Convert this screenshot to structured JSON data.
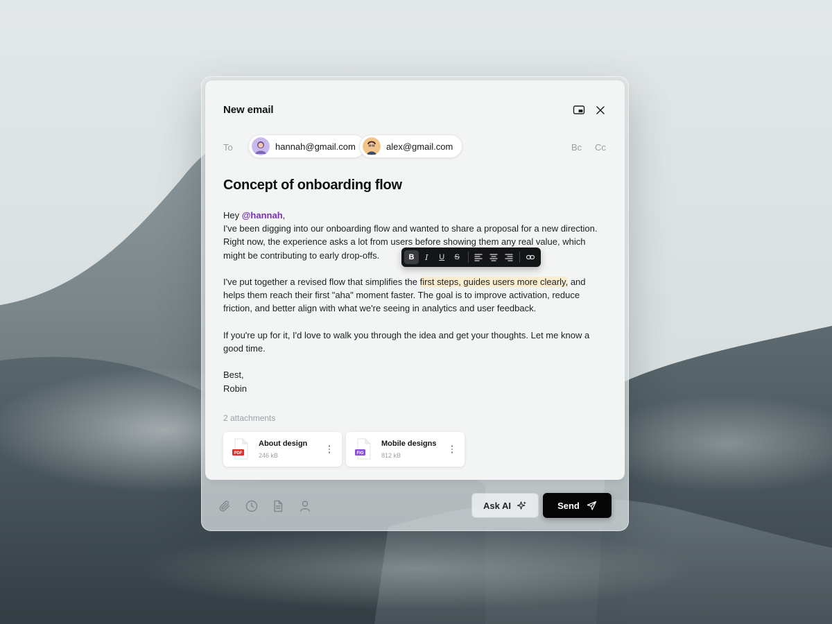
{
  "compose": {
    "title": "New email",
    "header_icons": [
      "minimize-window-icon",
      "close-icon"
    ]
  },
  "recipients": {
    "label": "To",
    "list": [
      {
        "email": "hannah@gmail.com",
        "avatar_color": "#c9b8ee"
      },
      {
        "email": "alex@gmail.com",
        "avatar_color": "#f2c48a"
      }
    ],
    "bcc_label": "Bc",
    "cc_label": "Cc"
  },
  "subject": "Concept of onboarding flow",
  "body": {
    "greeting": "Hey ",
    "mention": "@hannah",
    "greeting_end": ",",
    "p1": "I've been digging into our onboarding flow and wanted to share a proposal for a new direction. Right now, the experience asks a lot from users before showing them any real value, which might be contributing to early drop-offs.",
    "p2_before": "I've put together a revised flow that simplifies the ",
    "p2_highlight": "first steps, guides users more clearly,",
    "p2_after": " and helps them reach their first \"aha\" moment faster. The goal is to improve activation, reduce friction, and better align with what we're seeing in analytics and user feedback.",
    "p3": "If you're up for it, I'd love to walk you through the idea and get your thoughts. Let me know a good time.",
    "signoff": "Best,",
    "signature": "Robin",
    "highlight_color": "#faedd0",
    "mention_color": "#7a2fb5"
  },
  "formatting_toolbar": {
    "bold": "B",
    "italic": "I",
    "underline": "U",
    "strike": "S",
    "active": "bold"
  },
  "attachments": {
    "label": "2 attachments",
    "files": [
      {
        "name": "About design",
        "size": "246 kB",
        "type": "PDF",
        "type_color": "#d93025"
      },
      {
        "name": "Mobile designs",
        "size": "812 kB",
        "type": "FIG",
        "type_color": "#8a4fd6"
      }
    ]
  },
  "footer": {
    "tools": [
      "paperclip-icon",
      "clock-icon",
      "document-icon",
      "user-icon"
    ],
    "ask_ai_label": "Ask AI",
    "send_label": "Send"
  }
}
